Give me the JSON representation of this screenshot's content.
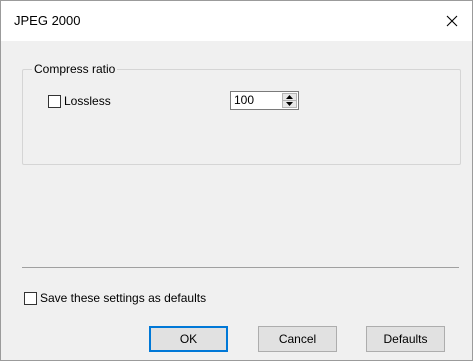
{
  "window": {
    "title": "JPEG 2000",
    "close_icon": "close-icon"
  },
  "compress_group": {
    "legend": "Compress ratio",
    "lossless": {
      "label": "Lossless",
      "checked": false
    },
    "ratio": {
      "value": "100"
    }
  },
  "save_defaults": {
    "label": "Save these settings as defaults",
    "checked": false
  },
  "buttons": {
    "ok": "OK",
    "cancel": "Cancel",
    "defaults": "Defaults"
  }
}
